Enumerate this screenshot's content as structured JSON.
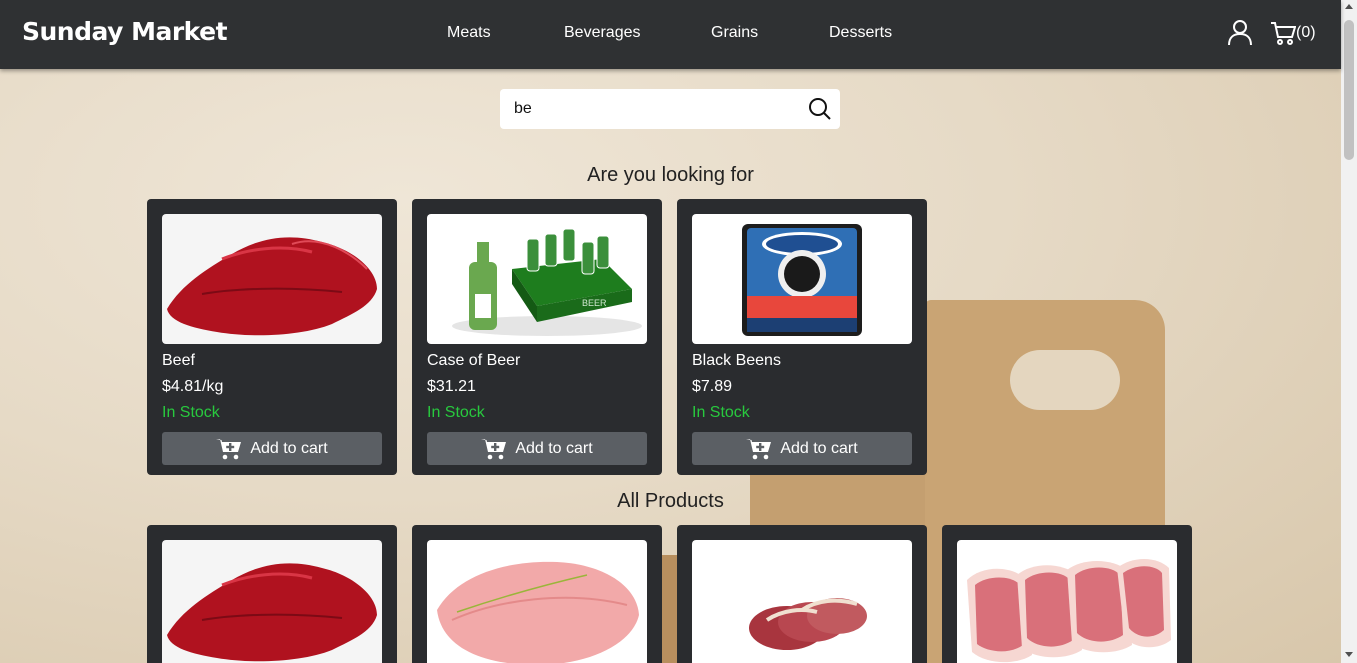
{
  "header": {
    "logo": "Sunday Market",
    "nav": [
      "Meats",
      "Beverages",
      "Grains",
      "Desserts"
    ],
    "cart_count": "(0)"
  },
  "search": {
    "value": "be"
  },
  "suggestions": {
    "title": "Are you looking for",
    "items": [
      {
        "name": "Beef",
        "price": "$4.81/kg",
        "stock": "In Stock",
        "button": "Add to cart",
        "image": "beef"
      },
      {
        "name": "Case of Beer",
        "price": "$31.21",
        "stock": "In Stock",
        "button": "Add to cart",
        "image": "beer"
      },
      {
        "name": "Black Beens",
        "price": "$7.89",
        "stock": "In Stock",
        "button": "Add to cart",
        "image": "beans"
      }
    ]
  },
  "products": {
    "title": "All Products",
    "images": [
      "beef",
      "chicken-breast",
      "duck-breast",
      "pork-chops"
    ]
  },
  "colors": {
    "navbar": "#2f3133",
    "card": "#2a2c2f",
    "button": "#5b5f64",
    "stock": "#28c93e"
  }
}
